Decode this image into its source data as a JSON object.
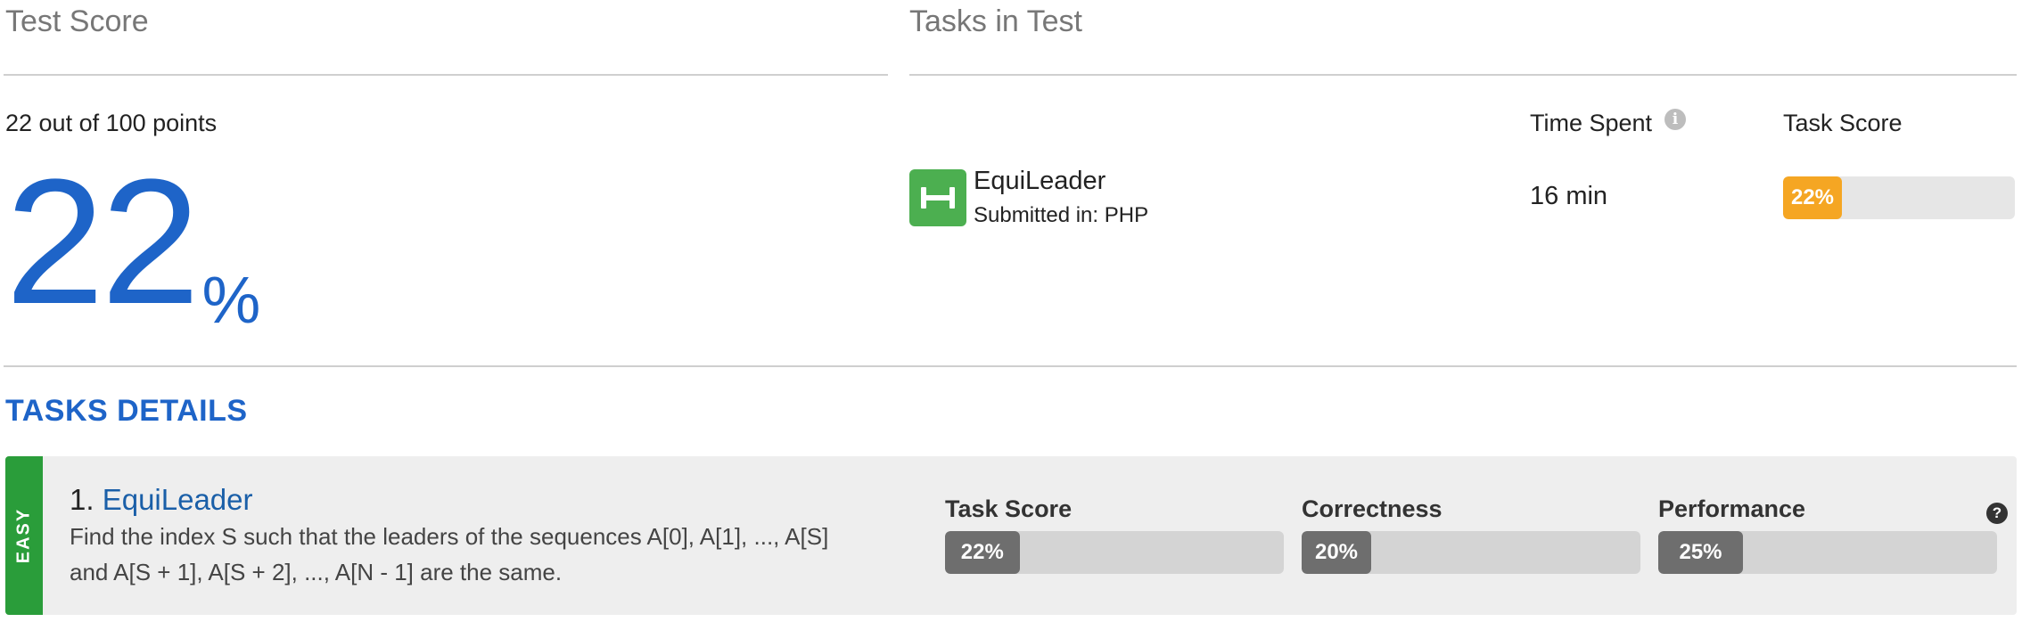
{
  "test_score": {
    "heading": "Test Score",
    "points_text": "22 out of 100 points",
    "percent_value": "22",
    "percent_sign": "%"
  },
  "tasks_in_test": {
    "heading": "Tasks in Test",
    "col_time": "Time Spent",
    "col_score": "Task Score",
    "info_icon": "i",
    "task": {
      "icon": "dumbbell-icon",
      "name": "EquiLeader",
      "submitted": "Submitted in: PHP",
      "time": "16 min",
      "score_label": "22%",
      "score_fraction": 0.22,
      "score_color": "#f5a623"
    }
  },
  "details": {
    "heading": "TASKS DETAILS",
    "card": {
      "difficulty": "EASY",
      "difficulty_color": "#2a9d3a",
      "number": "1.",
      "name": "EquiLeader",
      "desc_line1": "Find the index S such that the leaders of the sequences A[0], A[1], ..., A[S]",
      "desc_line2": "and A[S + 1], A[S + 2], ..., A[N - 1] are the same.",
      "help_icon": "?",
      "metrics": [
        {
          "label": "Task Score",
          "value": "22%",
          "fraction": 0.22
        },
        {
          "label": "Correctness",
          "value": "20%",
          "fraction": 0.2
        },
        {
          "label": "Performance",
          "value": "25%",
          "fraction": 0.25
        }
      ]
    }
  }
}
